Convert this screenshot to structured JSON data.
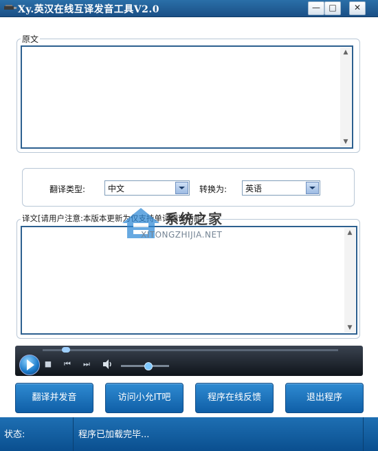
{
  "app": {
    "title": "Xy.英汉在线互译发音工具V2.0"
  },
  "source": {
    "label": "原文",
    "text": ""
  },
  "options": {
    "type_label": "翻译类型:",
    "type_value": "中文",
    "target_label": "转换为:",
    "target_value": "英语"
  },
  "result": {
    "label": "译文[请用户注意:本版本更新为仅支持单词翻译功能]",
    "text": ""
  },
  "watermark": {
    "text": "系统之家",
    "sub": "XITONGZHIJIA.NET"
  },
  "buttons": {
    "translate": "翻译并发音",
    "visit": "访问小允IT吧",
    "feedback": "程序在线反馈",
    "exit": "退出程序"
  },
  "status": {
    "label": "状态:",
    "message": "程序已加载完毕..."
  },
  "player": {
    "seek_fraction": 0.08,
    "volume_fraction": 0.55
  },
  "colors": {
    "accent": "#1a6fb8",
    "titlebar": "#1f5f99"
  }
}
